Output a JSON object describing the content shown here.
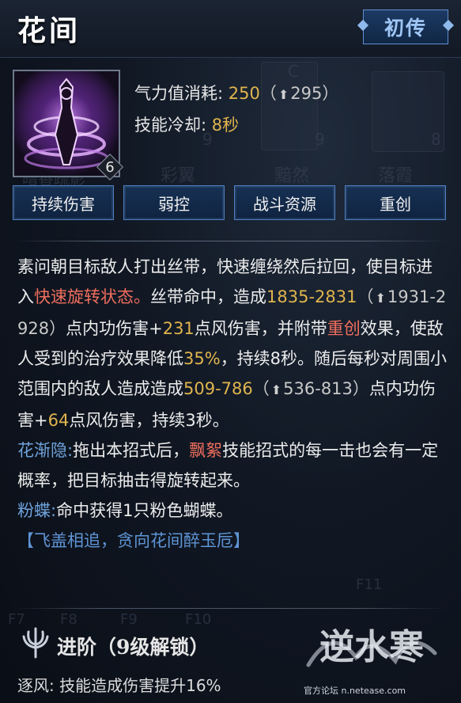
{
  "header": {
    "title": "花间",
    "badge": "初传"
  },
  "skill": {
    "level": "6",
    "cost_label": "气力值消耗:",
    "cost_value": "250",
    "cost_upgrade": "295",
    "cooldown_label": "技能冷却:",
    "cooldown_value": "8秒"
  },
  "tags": [
    "持续伤害",
    "弱控",
    "战斗资源",
    "重创"
  ],
  "description": {
    "p1_a": "素问朝目标敌人打出丝带，快速缠绕然后拉回，使目标进入",
    "p1_state": "快速旋转状态。",
    "p1_b": "丝带命中，造成",
    "dmg1": "1835-2831",
    "dmg1_up": "1931-2928",
    "p1_c": "点内功伤害+",
    "wind1": "231",
    "p1_d": "点风伤害，并附带",
    "heavy": "重创",
    "p1_e": "效果，使敌人受到的治疗效果降低",
    "heal_pct": "35%",
    "p1_f": "，持续8秒。随后每秒对周围小范围内的敌人造成造成",
    "dmg2": "509-786",
    "dmg2_up": "536-813",
    "p1_g": "点内功伤害+",
    "wind2": "64",
    "p1_h": "点风伤害，持续3秒。",
    "p2_label": "花渐隐:",
    "p2_a": "拖出本招式后，",
    "p2_skill": "飘絮",
    "p2_b": "技能招式的每一击也会有一定概率，把目标抽击得旋转起来。",
    "p3_label": "粉蝶:",
    "p3_text": "命中获得1只粉色蝴蝶。",
    "quote": "【飞盖相追，贪向花间醉玉卮】"
  },
  "advance": {
    "title": "进阶（9级解锁）",
    "item_label": "逐风:",
    "item_text": "技能造成伤害提升16%"
  },
  "watermark": {
    "logo_text": "逆水寒",
    "caption": "官方论坛 n.netease.com"
  },
  "background": {
    "hints": [
      "暗香疏影",
      "彩翼",
      "黯然",
      "落霞",
      "C",
      "9",
      "9",
      "8",
      "F7",
      "F8",
      "F9",
      "F10",
      "F11"
    ]
  },
  "colors": {
    "gold": "#e0b44e",
    "red": "#ef6e5e",
    "blue": "#6fa3dc",
    "tag_border": "#4f7fbf"
  }
}
